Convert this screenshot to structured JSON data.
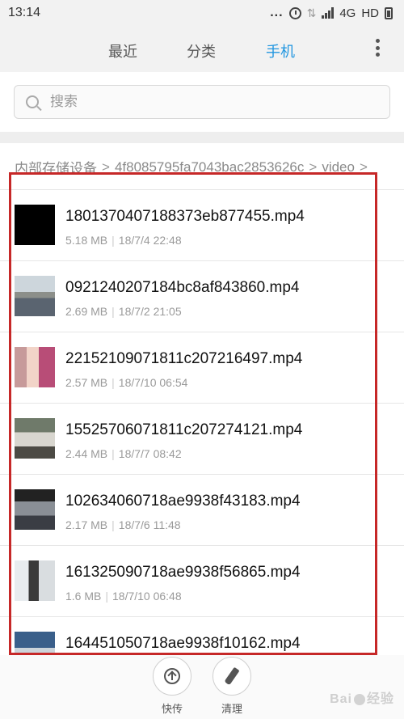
{
  "status_bar": {
    "time": "13:14",
    "dots": "...",
    "network": "4G",
    "hd": "HD"
  },
  "tabs": [
    {
      "label": "最近",
      "active": false
    },
    {
      "label": "分类",
      "active": false
    },
    {
      "label": "手机",
      "active": true
    }
  ],
  "colors": {
    "accent": "#2196e0",
    "highlight": "#c62828"
  },
  "search": {
    "placeholder": "搜索"
  },
  "breadcrumb": {
    "root": "内部存储设备",
    "folder": "4f8085795fa7043bac2853626c",
    "current": "video"
  },
  "files": [
    {
      "name": "1801370407188373eb877455.mp4",
      "size": "5.18 MB",
      "date": "18/7/4 22:48",
      "thumb": "black"
    },
    {
      "name": "0921240207184bc8af843860.mp4",
      "size": "2.69 MB",
      "date": "18/7/2 21:05",
      "thumb": "street"
    },
    {
      "name": "22152109071811c207216497.mp4",
      "size": "2.57 MB",
      "date": "18/7/10 06:54",
      "thumb": "people"
    },
    {
      "name": "15525706071811c207274121.mp4",
      "size": "2.44 MB",
      "date": "18/7/7 08:42",
      "thumb": "crowd"
    },
    {
      "name": "102634060718ae9938f43183.mp4",
      "size": "2.17 MB",
      "date": "18/7/6 11:48",
      "thumb": "room"
    },
    {
      "name": "161325090718ae9938f56865.mp4",
      "size": "1.6 MB",
      "date": "18/7/10 06:48",
      "thumb": "person"
    },
    {
      "name": "164451050718ae9938f10162.mp4",
      "size": "",
      "date": "",
      "thumb": "partial"
    }
  ],
  "actions": [
    {
      "label": "快传",
      "icon": "upload-icon"
    },
    {
      "label": "清理",
      "icon": "broom-icon"
    }
  ],
  "watermark": {
    "text": "Bai",
    "suffix": "经验"
  }
}
